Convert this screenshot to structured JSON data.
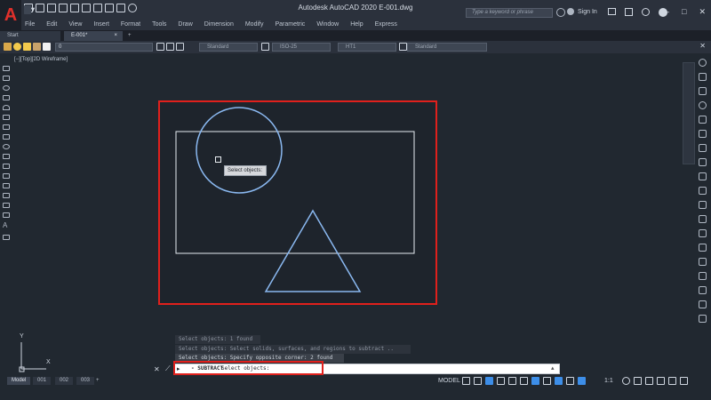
{
  "window": {
    "title": "Autodesk AutoCAD 2020   E-001.dwg",
    "search_placeholder": "Type a keyword or phrase",
    "sign_in": "Sign In",
    "controls": [
      "–",
      "□",
      "✕"
    ]
  },
  "logo": "A",
  "menu": [
    "File",
    "Edit",
    "View",
    "Insert",
    "Format",
    "Tools",
    "Draw",
    "Dimension",
    "Modify",
    "Parametric",
    "Window",
    "Help",
    "Express"
  ],
  "tabs": {
    "start": "Start",
    "file": "E-001*",
    "close": "×",
    "add": "+"
  },
  "toolbar": {
    "layer": "0",
    "dropdowns": [
      "Standard",
      "ISO-25",
      "HT1",
      "Standard"
    ],
    "close": "✕"
  },
  "viewport_label": "[−][Top][2D Wireframe]",
  "tooltip": "Select objects:",
  "command_history": [
    "Select objects: 1 found",
    "Select objects:  Select solids, surfaces, and regions to subtract ..",
    "Select objects: Specify opposite corner: 2 found"
  ],
  "command_line": {
    "icon": "▸",
    "name": "- SUBTRACT",
    "prompt": "Select objects:",
    "close": "✕",
    "wrench": "⟋",
    "arrow": "▴"
  },
  "ucs": {
    "y": "Y",
    "x": "X"
  },
  "layout_tabs": [
    "Model",
    "001",
    "002",
    "003"
  ],
  "layout_add": "+",
  "status": {
    "model": "MODEL",
    "scale": "1:1"
  },
  "colors": {
    "background": "#212830",
    "highlight": "#e0201c",
    "geometry": "#e6ecf2",
    "selected": "#8ab8f0",
    "accent": "#3d8ee8"
  }
}
